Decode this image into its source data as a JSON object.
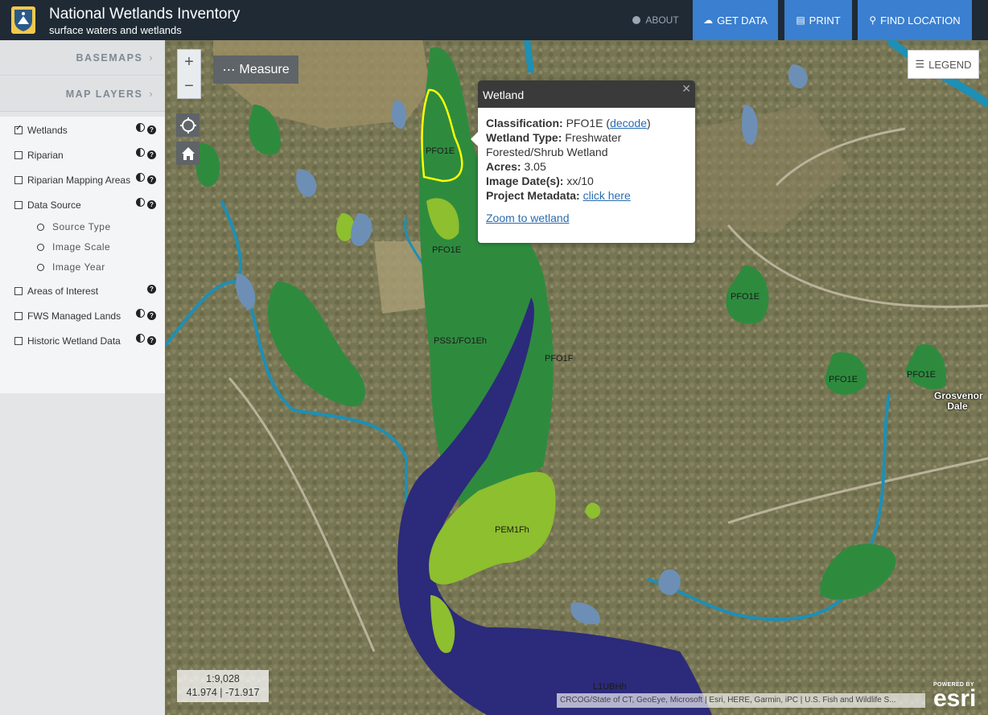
{
  "header": {
    "title": "National Wetlands Inventory",
    "subtitle": "surface waters and wetlands",
    "logo_icon": "fws-shield-icon",
    "nav": {
      "about": "ABOUT",
      "get_data": "GET DATA",
      "print": "PRINT",
      "find_location": "FIND LOCATION"
    },
    "colors": {
      "bar": "#1f2a35",
      "button": "#3a7fd0"
    }
  },
  "sidebar": {
    "basemaps": "BASEMAPS",
    "map_layers": "MAP LAYERS",
    "layers": [
      {
        "label": "Wetlands",
        "checked": true
      },
      {
        "label": "Riparian",
        "checked": false
      },
      {
        "label": "Riparian Mapping Areas",
        "checked": false
      },
      {
        "label": "Data Source",
        "checked": false
      },
      {
        "label": "Areas of Interest",
        "checked": false
      },
      {
        "label": "FWS Managed Lands",
        "checked": false
      },
      {
        "label": "Historic Wetland Data",
        "checked": false
      }
    ],
    "data_source_options": [
      "Source Type",
      "Image Scale",
      "Image Year"
    ]
  },
  "map": {
    "controls": {
      "zoom_in": "+",
      "zoom_out": "−",
      "measure": "Measure",
      "legend": "LEGEND"
    },
    "popup": {
      "title": "Wetland",
      "classification_label": "Classification:",
      "classification_value": "PFO1E",
      "decode_link": "decode",
      "wetland_type_label": "Wetland Type:",
      "wetland_type_value": "Freshwater Forested/Shrub Wetland",
      "acres_label": "Acres:",
      "acres_value": "3.05",
      "image_date_label": "Image Date(s):",
      "image_date_value": "xx/10",
      "project_metadata_label": "Project Metadata:",
      "project_metadata_link": "click here",
      "zoom_link": "Zoom to wetland"
    },
    "polygon_labels": [
      "PFO1E",
      "PFO1E",
      "PSS1/FO1Eh",
      "PFO1F",
      "PEM1Fh",
      "PFO1E",
      "PFO1E",
      "PFO1E",
      "L1UBHh"
    ],
    "place_label": "Grosvenor Dale",
    "scale": "1:9,028",
    "coordinates": "41.974 | -71.917",
    "attribution": "CRCOG/State of CT, GeoEye, Microsoft | Esri, HERE, Garmin, iPC | U.S. Fish and Wildlife S...",
    "esri_powered": "POWERED BY",
    "esri_word": "esri",
    "colors": {
      "forested": "#2e8b3e",
      "emergent": "#8dbf2e",
      "lake": "#2c2a7a",
      "pond": "#6d8fb5",
      "stream": "#1e8fb5",
      "highlight": "#ffff00"
    }
  }
}
